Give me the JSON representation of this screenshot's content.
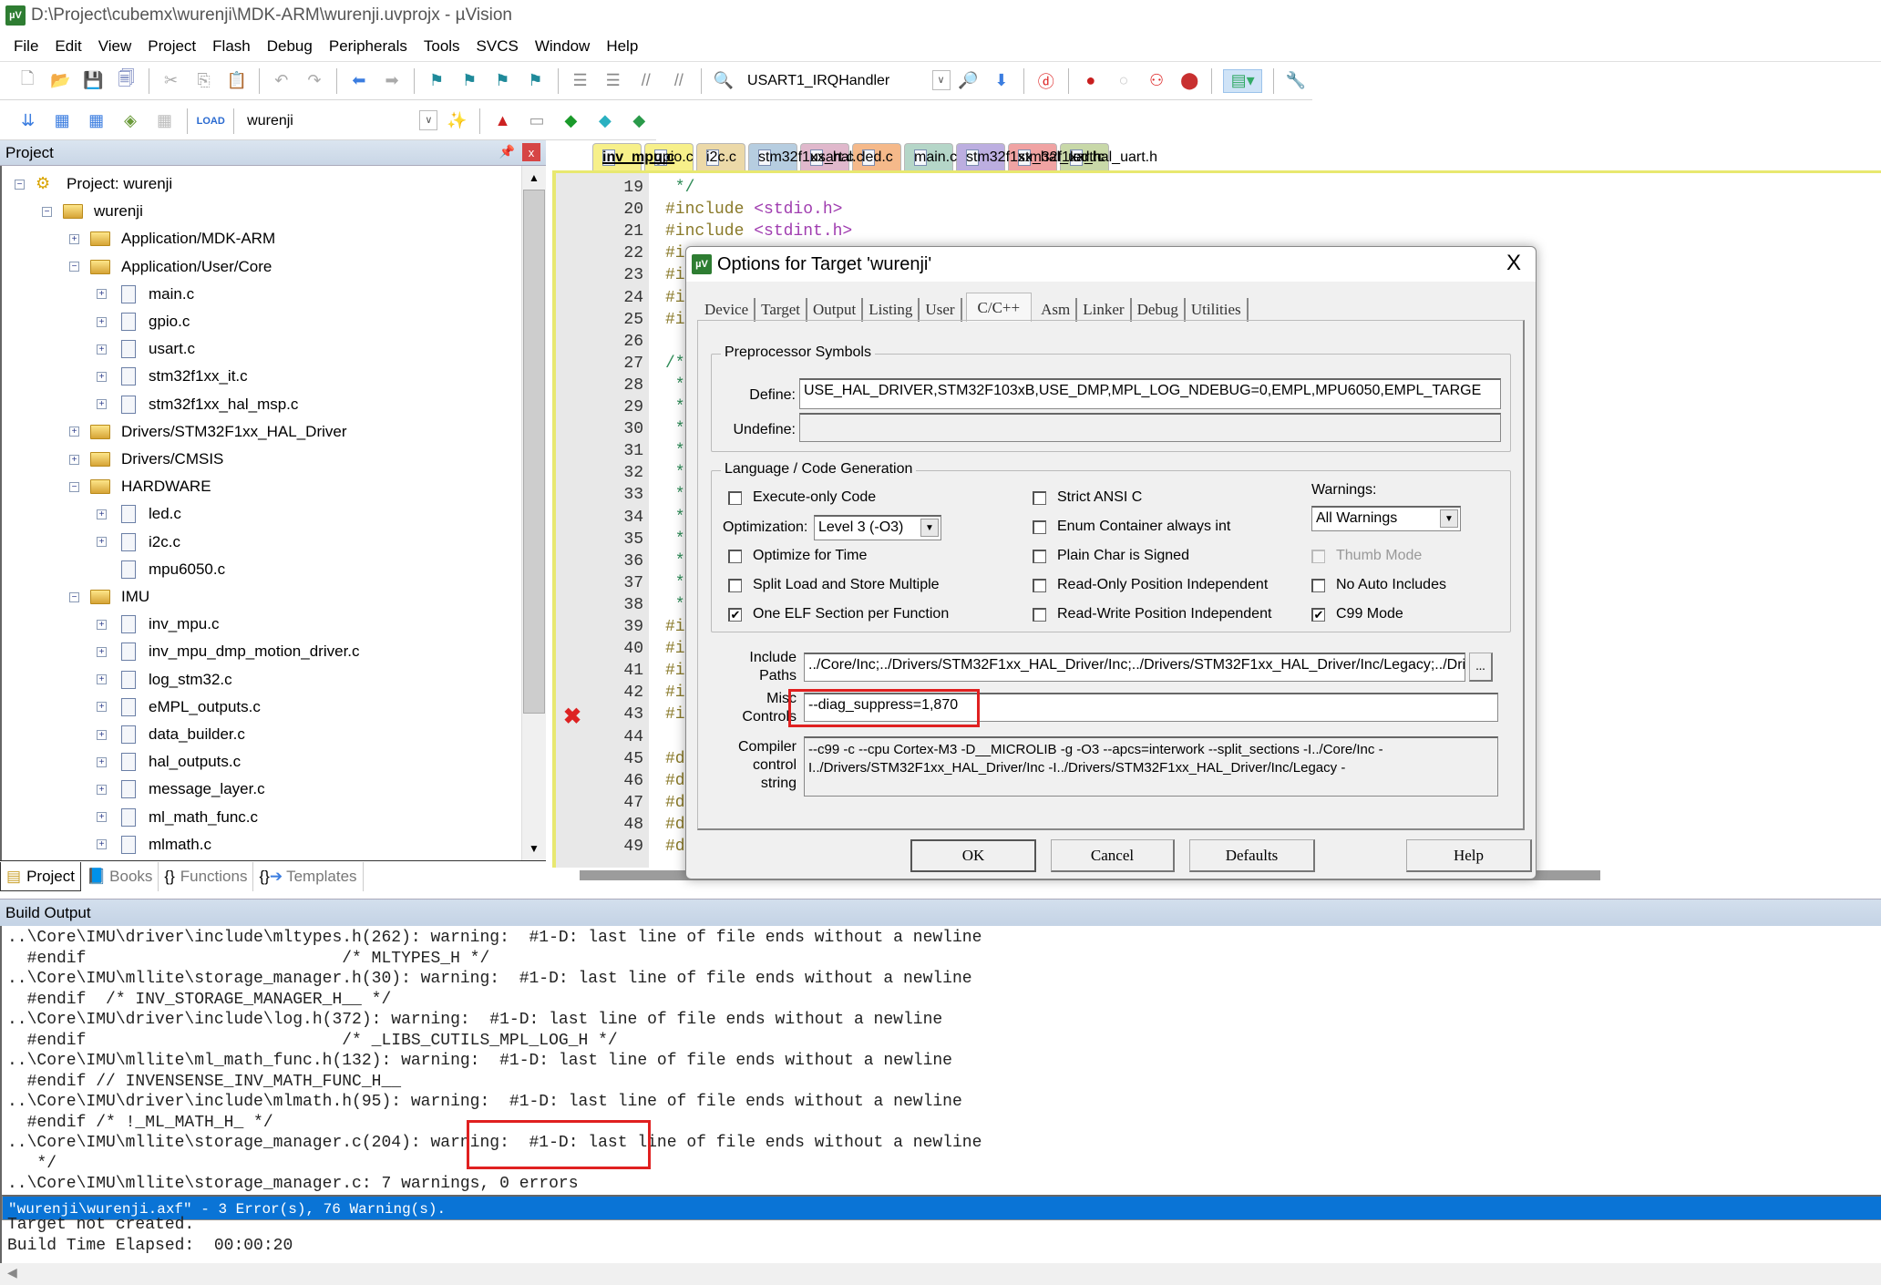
{
  "window": {
    "title": "D:\\Project\\cubemx\\wurenji\\MDK-ARM\\wurenji.uvprojx - µVision",
    "app_icon": "uvision-icon"
  },
  "menu": [
    "File",
    "Edit",
    "View",
    "Project",
    "Flash",
    "Debug",
    "Peripherals",
    "Tools",
    "SVCS",
    "Window",
    "Help"
  ],
  "toolbar1": {
    "icons_left": [
      "new-file-icon",
      "open-icon",
      "save-icon",
      "save-all-icon",
      "cut-icon",
      "copy-icon",
      "paste-icon",
      "undo-icon",
      "redo-icon",
      "nav-back-icon",
      "nav-forward-icon",
      "bookmark-icon",
      "bookmark-prev-icon",
      "bookmark-next-icon",
      "bookmark-clear-icon",
      "indent-icon",
      "unindent-icon",
      "comment-icon",
      "uncomment-icon",
      "find-in-files-icon"
    ],
    "function_combo": "USART1_IRQHandler",
    "icons_right": [
      "find-icon",
      "incremental-find-icon",
      "debug-session-icon",
      "breakpoint-insert-icon",
      "breakpoint-disable-icon",
      "breakpoint-disable-all-icon",
      "breakpoint-kill-all-icon",
      "window-layout-icon",
      "configure-icon"
    ]
  },
  "toolbar2": {
    "icons_left": [
      "translate-icon",
      "build-icon",
      "rebuild-icon",
      "batch-build-icon",
      "stop-build-icon",
      "download-icon"
    ],
    "target_combo": "wurenji",
    "icons_right": [
      "target-options-icon",
      "manage-components-icon",
      "select-packs-icon",
      "pack-installer-icon",
      "rte-icon",
      "manage-project-items-icon"
    ]
  },
  "project_pane": {
    "title": "Project",
    "tree": [
      {
        "label": "Project: wurenji",
        "level": 0,
        "expander": "minus",
        "icon": "project"
      },
      {
        "label": "wurenji",
        "level": 1,
        "expander": "minus",
        "icon": "target-folder"
      },
      {
        "label": "Application/MDK-ARM",
        "level": 2,
        "expander": "plus",
        "icon": "folder"
      },
      {
        "label": "Application/User/Core",
        "level": 2,
        "expander": "minus",
        "icon": "folder-open"
      },
      {
        "label": "main.c",
        "level": 3,
        "expander": "plus",
        "icon": "file"
      },
      {
        "label": "gpio.c",
        "level": 3,
        "expander": "plus",
        "icon": "file"
      },
      {
        "label": "usart.c",
        "level": 3,
        "expander": "plus",
        "icon": "file-gear"
      },
      {
        "label": "stm32f1xx_it.c",
        "level": 3,
        "expander": "plus",
        "icon": "file"
      },
      {
        "label": "stm32f1xx_hal_msp.c",
        "level": 3,
        "expander": "plus",
        "icon": "file"
      },
      {
        "label": "Drivers/STM32F1xx_HAL_Driver",
        "level": 2,
        "expander": "plus",
        "icon": "folder"
      },
      {
        "label": "Drivers/CMSIS",
        "level": 2,
        "expander": "plus",
        "icon": "folder"
      },
      {
        "label": "HARDWARE",
        "level": 2,
        "expander": "minus",
        "icon": "folder-open"
      },
      {
        "label": "led.c",
        "level": 3,
        "expander": "plus",
        "icon": "file"
      },
      {
        "label": "i2c.c",
        "level": 3,
        "expander": "plus",
        "icon": "file"
      },
      {
        "label": "mpu6050.c",
        "level": 3,
        "expander": "none",
        "icon": "file"
      },
      {
        "label": "IMU",
        "level": 2,
        "expander": "minus",
        "icon": "folder-open"
      },
      {
        "label": "inv_mpu.c",
        "level": 3,
        "expander": "plus",
        "icon": "file"
      },
      {
        "label": "inv_mpu_dmp_motion_driver.c",
        "level": 3,
        "expander": "plus",
        "icon": "file"
      },
      {
        "label": "log_stm32.c",
        "level": 3,
        "expander": "plus",
        "icon": "file"
      },
      {
        "label": "eMPL_outputs.c",
        "level": 3,
        "expander": "plus",
        "icon": "file"
      },
      {
        "label": "data_builder.c",
        "level": 3,
        "expander": "plus",
        "icon": "file"
      },
      {
        "label": "hal_outputs.c",
        "level": 3,
        "expander": "plus",
        "icon": "file"
      },
      {
        "label": "message_layer.c",
        "level": 3,
        "expander": "plus",
        "icon": "file"
      },
      {
        "label": "ml_math_func.c",
        "level": 3,
        "expander": "plus",
        "icon": "file"
      },
      {
        "label": "mlmath.c",
        "level": 3,
        "expander": "plus",
        "icon": "file"
      }
    ],
    "bottom_tabs": [
      {
        "label": "Project",
        "icon": "project-tab-icon",
        "active": true
      },
      {
        "label": "Books",
        "icon": "books-icon",
        "active": false
      },
      {
        "label": "Functions",
        "icon": "functions-icon",
        "active": false
      },
      {
        "label": "Templates",
        "icon": "templates-icon",
        "active": false
      }
    ]
  },
  "editor": {
    "tabs": [
      {
        "label": "inv_mpu.c",
        "color": "#f7f08a",
        "active": true
      },
      {
        "label": "gpio.c",
        "color": "#f7f08a",
        "active": false
      },
      {
        "label": "i2c.c",
        "color": "#ecd9a8",
        "active": false
      },
      {
        "label": "stm32f1xx_hal.c",
        "color": "#b6cde0",
        "active": false
      },
      {
        "label": "usart.c",
        "color": "#e0b8cc",
        "active": false
      },
      {
        "label": "led.c",
        "color": "#f5b98a",
        "active": false
      },
      {
        "label": "main.c",
        "color": "#b5d6c8",
        "active": false
      },
      {
        "label": "stm32f1xx_hal_uart.c",
        "color": "#bcaee0",
        "active": false
      },
      {
        "label": "stm32f1xx_hal_uart.h",
        "color": "#f0a3a3",
        "active": false
      },
      {
        "label": "led.h",
        "color": "#c8d8a8",
        "active": false
      }
    ],
    "lines": [
      {
        "n": "19",
        "text": " */",
        "type": "comment"
      },
      {
        "n": "20",
        "text": "#include <stdio.h>",
        "type": "include"
      },
      {
        "n": "21",
        "text": "#include <stdint.h>",
        "type": "include"
      },
      {
        "n": "22",
        "text": "#i",
        "type": "pre"
      },
      {
        "n": "23",
        "text": "#i",
        "type": "pre"
      },
      {
        "n": "24",
        "text": "#i",
        "type": "pre"
      },
      {
        "n": "25",
        "text": "#i",
        "type": "pre"
      },
      {
        "n": "26",
        "text": "",
        "type": "pre"
      },
      {
        "n": "27",
        "text": "/*",
        "type": "comment"
      },
      {
        "n": "28",
        "text": " *",
        "type": "comment"
      },
      {
        "n": "29",
        "text": " *",
        "type": "comment"
      },
      {
        "n": "30",
        "text": " *",
        "type": "comment"
      },
      {
        "n": "31",
        "text": " *",
        "type": "comment"
      },
      {
        "n": "32",
        "text": " *",
        "type": "comment"
      },
      {
        "n": "33",
        "text": " *",
        "type": "comment"
      },
      {
        "n": "34",
        "text": " *",
        "type": "comment"
      },
      {
        "n": "35",
        "text": " *",
        "type": "comment"
      },
      {
        "n": "36",
        "text": " *",
        "type": "comment"
      },
      {
        "n": "37",
        "text": " *",
        "type": "comment"
      },
      {
        "n": "38",
        "text": " *",
        "type": "comment"
      },
      {
        "n": "39",
        "text": "#i",
        "type": "pre"
      },
      {
        "n": "40",
        "text": "#i",
        "type": "pre"
      },
      {
        "n": "41",
        "text": "#i",
        "type": "pre"
      },
      {
        "n": "42",
        "text": "#i",
        "type": "pre"
      },
      {
        "n": "43",
        "text": "#i",
        "type": "pre"
      },
      {
        "n": "44",
        "text": "",
        "type": "pre"
      },
      {
        "n": "45",
        "text": "#d",
        "type": "pre"
      },
      {
        "n": "46",
        "text": "#d",
        "type": "pre"
      },
      {
        "n": "47",
        "text": "#d",
        "type": "pre"
      },
      {
        "n": "48",
        "text": "#d",
        "type": "pre"
      },
      {
        "n": "49",
        "text": "#d",
        "type": "pre"
      }
    ],
    "error_line": "43"
  },
  "dialog": {
    "title": "Options for Target 'wurenji'",
    "close": "X",
    "tabs": [
      "Device",
      "Target",
      "Output",
      "Listing",
      "User",
      "C/C++",
      "Asm",
      "Linker",
      "Debug",
      "Utilities"
    ],
    "active_tab": "C/C++",
    "preprocessor": {
      "group_label": "Preprocessor Symbols",
      "define_label": "Define:",
      "define_value": "USE_HAL_DRIVER,STM32F103xB,USE_DMP,MPL_LOG_NDEBUG=0,EMPL,MPU6050,EMPL_TARGE",
      "undefine_label": "Undefine:",
      "undefine_value": ""
    },
    "language": {
      "group_label": "Language / Code Generation",
      "execute_only": {
        "label": "Execute-only Code",
        "checked": false
      },
      "optimization_label": "Optimization:",
      "optimization_value": "Level 3 (-O3)",
      "optimize_time": {
        "label": "Optimize for Time",
        "checked": false
      },
      "split_ldm": {
        "label": "Split Load and Store Multiple",
        "checked": false
      },
      "one_elf": {
        "label": "One ELF Section per Function",
        "checked": true
      },
      "strict_ansi": {
        "label": "Strict ANSI C",
        "checked": false
      },
      "enum_int": {
        "label": "Enum Container always int",
        "checked": false
      },
      "plain_char": {
        "label": "Plain Char is Signed",
        "checked": false
      },
      "ropi": {
        "label": "Read-Only Position Independent",
        "checked": false
      },
      "rwpi": {
        "label": "Read-Write Position Independent",
        "checked": false
      },
      "warnings_label": "Warnings:",
      "warnings_value": "All Warnings",
      "thumb_mode": {
        "label": "Thumb Mode",
        "checked": false,
        "disabled": true
      },
      "no_auto_includes": {
        "label": "No Auto Includes",
        "checked": false
      },
      "c99_mode": {
        "label": "C99 Mode",
        "checked": true
      }
    },
    "include_label": "Include\nPaths",
    "include_value": "../Core/Inc;../Drivers/STM32F1xx_HAL_Driver/Inc;../Drivers/STM32F1xx_HAL_Driver/Inc/Legacy;../Driv",
    "include_browse": "...",
    "misc_label": "Misc\nControls",
    "misc_value": "--diag_suppress=1,870",
    "compiler_label": "Compiler\ncontrol\nstring",
    "compiler_value_1": "--c99 -c --cpu Cortex-M3 -D__MICROLIB -g -O3 --apcs=interwork --split_sections -I../Core/Inc -",
    "compiler_value_2": "I../Drivers/STM32F1xx_HAL_Driver/Inc -I../Drivers/STM32F1xx_HAL_Driver/Inc/Legacy -",
    "buttons": {
      "ok": "OK",
      "cancel": "Cancel",
      "defaults": "Defaults",
      "help": "Help"
    }
  },
  "build_output": {
    "title": "Build Output",
    "lines": [
      "..\\Core\\IMU\\driver\\include\\mltypes.h(262): warning:  #1-D: last line of file ends without a newline",
      "  #endif                          /* MLTYPES_H */",
      "..\\Core\\IMU\\mllite\\storage_manager.h(30): warning:  #1-D: last line of file ends without a newline",
      "  #endif  /* INV_STORAGE_MANAGER_H__ */",
      "..\\Core\\IMU\\driver\\include\\log.h(372): warning:  #1-D: last line of file ends without a newline",
      "  #endif                          /* _LIBS_CUTILS_MPL_LOG_H */",
      "..\\Core\\IMU\\mllite\\ml_math_func.h(132): warning:  #1-D: last line of file ends without a newline",
      "  #endif // INVENSENSE_INV_MATH_FUNC_H__",
      "..\\Core\\IMU\\driver\\include\\mlmath.h(95): warning:  #1-D: last line of file ends without a newline",
      "  #endif /* !_ML_MATH_H_ */",
      "..\\Core\\IMU\\mllite\\storage_manager.c(204): warning:  #1-D: last line of file ends without a newline",
      "   */",
      "..\\Core\\IMU\\mllite\\storage_manager.c: 7 warnings, 0 errors",
      "\"wurenji\\wurenji.axf\" - 3 Error(s), 76 Warning(s).",
      "Target not created.",
      "Build Time Elapsed:  00:00:20"
    ],
    "selected_line": 13
  },
  "highlight_color": "#e02020",
  "selection_color": "#0a74d6"
}
